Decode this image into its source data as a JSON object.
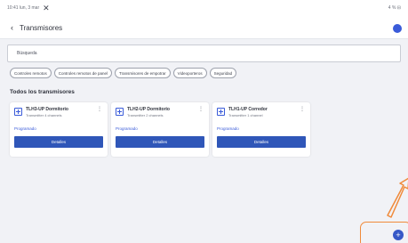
{
  "status": {
    "left_text": "10:41 lun, 3 mar",
    "close_glyph": "✕",
    "right_text": "4 % ⊟"
  },
  "appbar": {
    "back_icon": "‹",
    "title": "Transmisores"
  },
  "search": {
    "placeholder": "Búsqueda"
  },
  "filters": [
    "Controles remotos",
    "Controles remotos de panel",
    "Transmisores de empotrar",
    "Videoporteros",
    "Seguridad"
  ],
  "section": {
    "title": "Todos los transmisores"
  },
  "transmitters": [
    {
      "name": "TLH3-UP Dormitorio",
      "description": "Transmitter 4 channels",
      "status": "Programado",
      "action": "Detalles"
    },
    {
      "name": "TLH2-UP Dormitorio",
      "description": "Transmitter 2 channels",
      "status": "Programado",
      "action": "Detalles"
    },
    {
      "name": "TLH1-UP Corredor",
      "description": "Transmitter 1 channel",
      "status": "Programado",
      "action": "Detalles"
    }
  ],
  "fab": {
    "label": "+"
  },
  "colors": {
    "accent": "#3a5bd9",
    "button": "#2f56b8",
    "highlight": "#f08a3a"
  }
}
